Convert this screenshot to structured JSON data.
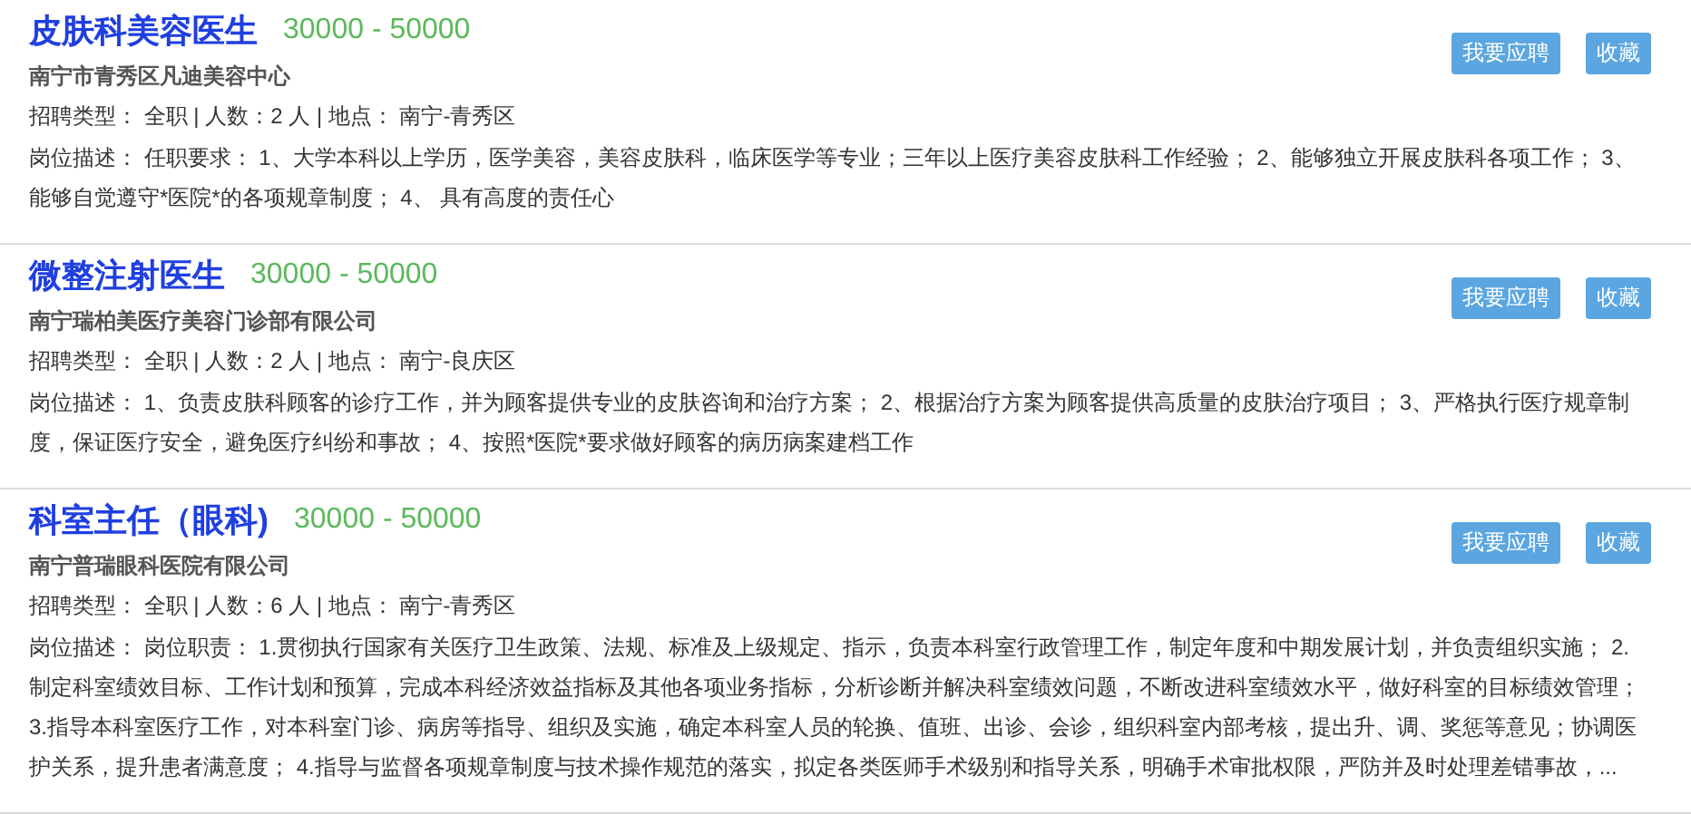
{
  "jobs": [
    {
      "title": "皮肤科美容医生",
      "salary": "30000 - 50000",
      "company": "南宁市青秀区凡迪美容中心",
      "info": "招聘类型： 全职 | 人数：2 人 | 地点： 南宁-青秀区",
      "description": "岗位描述： 任职要求： 1、大学本科以上学历，医学美容，美容皮肤科，临床医学等专业；三年以上医疗美容皮肤科工作经验； 2、能够独立开展皮肤科各项工作； 3、能够自觉遵守*医院*的各项规章制度； 4、 具有高度的责任心",
      "buttons": [
        "我要应聘",
        "收藏"
      ]
    },
    {
      "title": "微整注射医生",
      "salary": "30000 - 50000",
      "company": "南宁瑞柏美医疗美容门诊部有限公司",
      "info": "招聘类型： 全职 | 人数：2 人 | 地点： 南宁-良庆区",
      "description": "岗位描述： 1、负责皮肤科顾客的诊疗工作，并为顾客提供专业的皮肤咨询和治疗方案； 2、根据治疗方案为顾客提供高质量的皮肤治疗项目； 3、严格执行医疗规章制度，保证医疗安全，避免医疗纠纷和事故； 4、按照*医院*要求做好顾客的病历病案建档工作",
      "buttons": [
        "我要应聘",
        "收藏"
      ]
    },
    {
      "title": "科室主任（眼科)",
      "salary": "30000 - 50000",
      "company": "南宁普瑞眼科医院有限公司",
      "info": "招聘类型： 全职 | 人数：6 人 | 地点： 南宁-青秀区",
      "description": "岗位描述： 岗位职责： 1.贯彻执行国家有关医疗卫生政策、法规、标准及上级规定、指示，负责本科室行政管理工作，制定年度和中期发展计划，并负责组织实施； 2.制定科室绩效目标、工作计划和预算，完成本科经济效益指标及其他各项业务指标，分析诊断并解决科室绩效问题，不断改进科室绩效水平，做好科室的目标绩效管理； 3.指导本科室医疗工作，对本科室门诊、病房等指导、组织及实施，确定本科室人员的轮换、值班、出诊、会诊，组织科室内部考核，提出升、调、奖惩等意见；协调医护关系，提升患者满意度； 4.指导与监督各项规章制度与技术操作规范的落实，拟定各类医师手术级别和指导关系，明确手术审批权限，严防并及时处理差错事故，...",
      "buttons": [
        "我要应聘",
        "收藏"
      ]
    }
  ]
}
